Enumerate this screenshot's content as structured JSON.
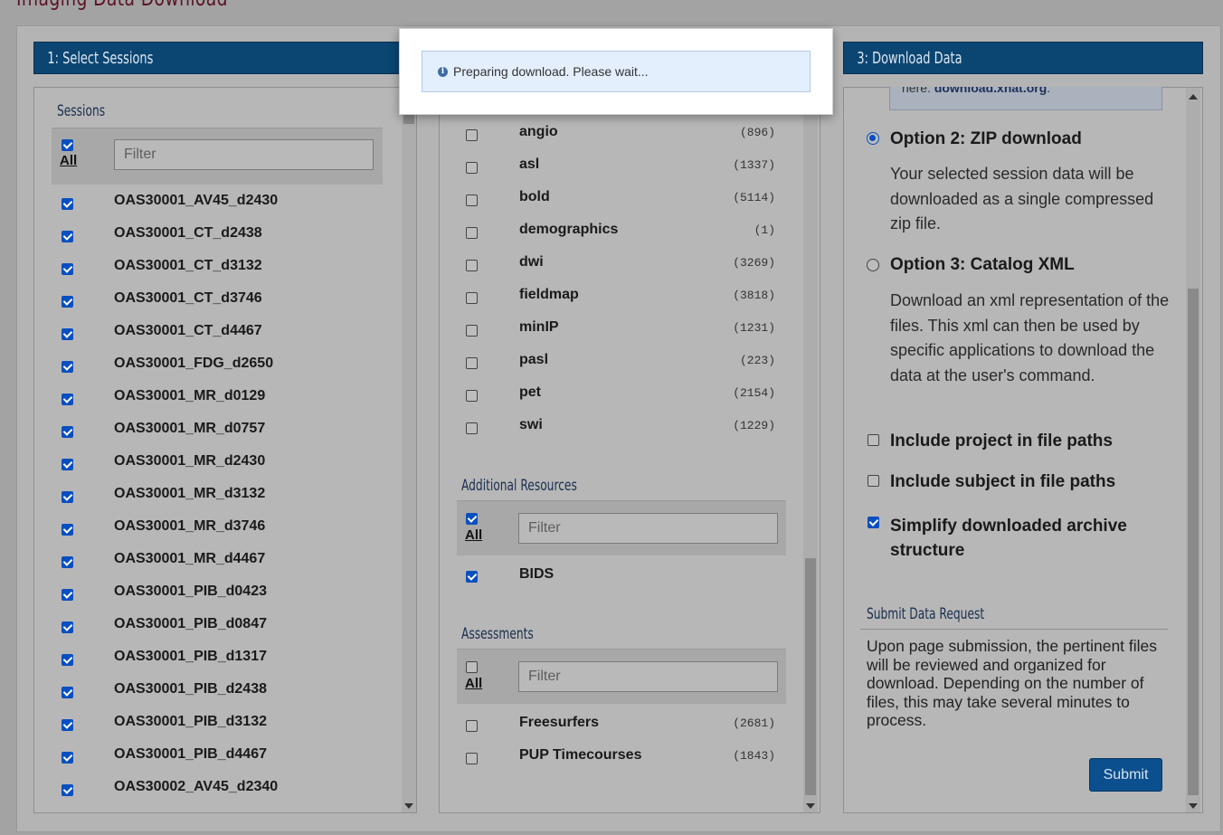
{
  "page": {
    "title": "Imaging Data Download"
  },
  "columns": {
    "col1": "1: Select Sessions",
    "col3": "3: Download Data"
  },
  "sessions": {
    "title": "Sessions",
    "all_label": "All",
    "all_checked": true,
    "filter_placeholder": "Filter",
    "items": [
      {
        "label": "OAS30001_AV45_d2430",
        "checked": true
      },
      {
        "label": "OAS30001_CT_d2438",
        "checked": true
      },
      {
        "label": "OAS30001_CT_d3132",
        "checked": true
      },
      {
        "label": "OAS30001_CT_d3746",
        "checked": true
      },
      {
        "label": "OAS30001_CT_d4467",
        "checked": true
      },
      {
        "label": "OAS30001_FDG_d2650",
        "checked": true
      },
      {
        "label": "OAS30001_MR_d0129",
        "checked": true
      },
      {
        "label": "OAS30001_MR_d0757",
        "checked": true
      },
      {
        "label": "OAS30001_MR_d2430",
        "checked": true
      },
      {
        "label": "OAS30001_MR_d3132",
        "checked": true
      },
      {
        "label": "OAS30001_MR_d3746",
        "checked": true
      },
      {
        "label": "OAS30001_MR_d4467",
        "checked": true
      },
      {
        "label": "OAS30001_PIB_d0423",
        "checked": true
      },
      {
        "label": "OAS30001_PIB_d0847",
        "checked": true
      },
      {
        "label": "OAS30001_PIB_d1317",
        "checked": true
      },
      {
        "label": "OAS30001_PIB_d2438",
        "checked": true
      },
      {
        "label": "OAS30001_PIB_d3132",
        "checked": true
      },
      {
        "label": "OAS30001_PIB_d4467",
        "checked": true
      },
      {
        "label": "OAS30002_AV45_d2340",
        "checked": true
      }
    ]
  },
  "scan_types": {
    "items": [
      {
        "label": "angio",
        "count": "(896)",
        "checked": false
      },
      {
        "label": "asl",
        "count": "(1337)",
        "checked": false
      },
      {
        "label": "bold",
        "count": "(5114)",
        "checked": false
      },
      {
        "label": "demographics",
        "count": "(1)",
        "checked": false
      },
      {
        "label": "dwi",
        "count": "(3269)",
        "checked": false
      },
      {
        "label": "fieldmap",
        "count": "(3818)",
        "checked": false
      },
      {
        "label": "minIP",
        "count": "(1231)",
        "checked": false
      },
      {
        "label": "pasl",
        "count": "(223)",
        "checked": false
      },
      {
        "label": "pet",
        "count": "(2154)",
        "checked": false
      },
      {
        "label": "swi",
        "count": "(1229)",
        "checked": false
      }
    ]
  },
  "additional_resources": {
    "title": "Additional Resources",
    "all_label": "All",
    "all_checked": true,
    "filter_placeholder": "Filter",
    "items": [
      {
        "label": "BIDS",
        "checked": true
      }
    ]
  },
  "assessments": {
    "title": "Assessments",
    "all_label": "All",
    "all_checked": false,
    "filter_placeholder": "Filter",
    "items": [
      {
        "label": "Freesurfers",
        "count": "(2681)",
        "checked": false
      },
      {
        "label": "PUP Timecourses",
        "count": "(1843)",
        "checked": false
      }
    ]
  },
  "download": {
    "info_text": "here: ",
    "info_link": "download.xnat.org",
    "info_suffix": ".",
    "option2": {
      "title": "Option 2: ZIP download",
      "desc": "Your selected session data will be downloaded as a single compressed zip file.",
      "selected": true
    },
    "option3": {
      "title": "Option 3: Catalog XML",
      "desc": "Download an xml representation of the files. This xml can then be used by specific applications to download the data at the user's command.",
      "selected": false
    },
    "include_project": {
      "label": "Include project in file paths",
      "checked": false
    },
    "include_subject": {
      "label": "Include subject in file paths",
      "checked": false
    },
    "simplify": {
      "label": "Simplify downloaded archive structure",
      "checked": true
    },
    "submit_title": "Submit Data Request",
    "submit_desc": "Upon page submission, the pertinent files will be reviewed and organized for download. Depending on the number of files, this may take several minutes to process.",
    "submit_label": "Submit"
  },
  "modal": {
    "message": "Preparing download. Please wait...",
    "icon": "info-circle-icon"
  }
}
